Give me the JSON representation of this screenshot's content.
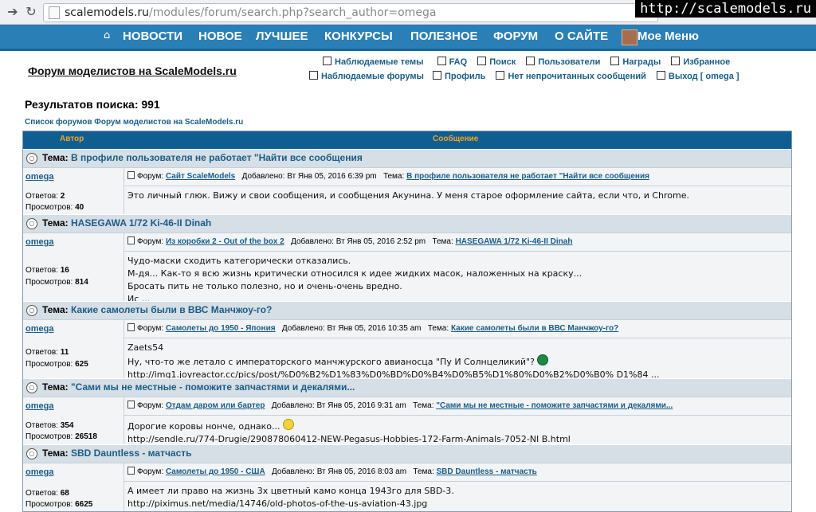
{
  "browser": {
    "back_icon": "back-arrow-icon",
    "refresh_icon": "refresh-icon",
    "url_host": "scalemodels.ru",
    "url_path": "/modules/forum/search.php?search_author=omega",
    "watermark": "http://scalemodels.ru"
  },
  "sitenav": {
    "home_icon": "home-icon",
    "items": [
      "НОВОСТИ",
      "НОВОЕ",
      "ЛУЧШЕЕ",
      "КОНКУРСЫ",
      "ПОЛЕЗНОЕ",
      "ФОРУМ",
      "О САЙТЕ",
      "Мое Меню"
    ]
  },
  "forum": {
    "title": "Форум моделистов на ScaleModels.ru",
    "links_row1": [
      "Наблюдаемые темы",
      "FAQ",
      "Поиск",
      "Пользователи",
      "Награды",
      "Избранное"
    ],
    "links_row2": [
      "Наблюдаемые форумы",
      "Профиль",
      "Нет непрочитанных сообщений",
      "Выход [ omega ]"
    ]
  },
  "results_title": "Результатов поиска: 991",
  "index_link": "Список форумов Форум моделистов на ScaleModels.ru",
  "table": {
    "col_author": "Автор",
    "col_message": "Сообщение",
    "topic_prefix": "Тема:",
    "forum_label": "Форум:",
    "added_label": "Добавлено:",
    "topic_label": "Тема:",
    "replies_label": "Ответов:",
    "views_label": "Просмотров:"
  },
  "posts": [
    {
      "topic": "В профиле пользователя не работает \"Найти все сообщения",
      "author": "omega",
      "replies": "2",
      "views": "40",
      "forum": "Сайт ScaleModels",
      "date": "Вт Янв 05, 2016 6:39 pm",
      "lines": [
        "Это личный глюк. Вижу и свои сообщения, и сообщения Акунина. У меня старое оформление сайта, если что, и Chrome."
      ]
    },
    {
      "topic": "HASEGAWA 1/72 Ki-46-II Dinah",
      "author": "omega",
      "replies": "16",
      "views": "814",
      "forum": "Из коробки 2 - Out of the box 2",
      "date": "Вт Янв 05, 2016 2:52 pm",
      "lines": [
        "Чудо-маски сходить категорически отказались.",
        "М-дя... Как-то я всю жизнь критически относился к идее жидких масок, наложенных на краску...",
        "Бросать пить не только полезно, но и очень-очень вредно.",
        "Ис ..."
      ]
    },
    {
      "topic": "Какие самолеты были в ВВС Манчжоу-го?",
      "author": "omega",
      "replies": "11",
      "views": "625",
      "forum": "Самолеты до 1950 - Япония",
      "date": "Вт Янв 05, 2016 10:35 am",
      "lines": [
        "Zaets54",
        "Ну, что-то же летало с императорского манчжурского авианосца \"Пу И Солнцеликий\"?",
        "http://img1.joyreactor.cc/pics/post/%D0%B2%D1%83%D0%BD%D0%B4%D0%B5%D1%80%D0%B2%D0%B0% D1%84 ..."
      ]
    },
    {
      "topic": "\"Сами мы не местные - поможите запчастями и декалями...",
      "author": "omega",
      "replies": "354",
      "views": "26518",
      "forum": "Отдам даром или бартер",
      "date": "Вт Янв 05, 2016 9:31 am",
      "lines": [
        "Дорогие коровы нонче, однако...",
        "http://sendle.ru/774-Drugie/290878060412-NEW-Pegasus-Hobbies-172-Farm-Animals-7052-NI B.html"
      ]
    },
    {
      "topic": "SBD Dauntless - матчасть",
      "author": "omega",
      "replies": "68",
      "views": "6625",
      "forum": "Самолеты до 1950 - США",
      "date": "Вт Янв 05, 2016 8:03 am",
      "lines": [
        "А имеет ли право на жизнь 3х цветный камо конца 1943го для SBD-3.",
        "http://piximus.net/media/14746/old-photos-of-the-us-aviation-43.jpg"
      ]
    }
  ]
}
